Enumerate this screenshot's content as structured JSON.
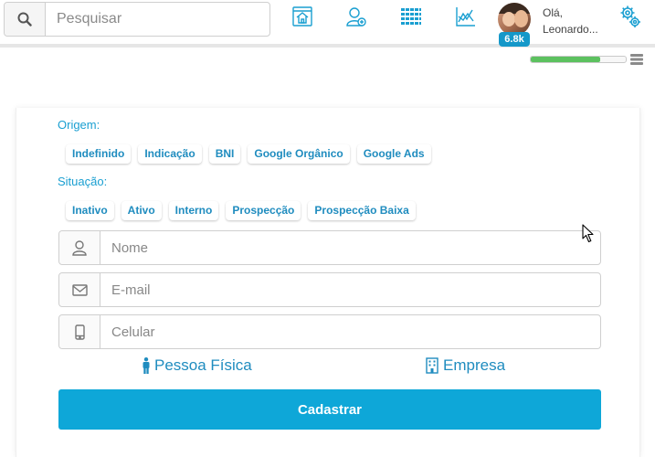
{
  "header": {
    "search_placeholder": "Pesquisar",
    "user": {
      "badge": "6.8k",
      "greeting_line1": "Olá,",
      "greeting_line2": "Leonardo..."
    },
    "nav_icons": [
      "home-icon",
      "add-user-icon",
      "calendar-grid-icon",
      "chart-icon"
    ],
    "progress_fraction": 0.73
  },
  "form": {
    "origem_label": "Origem:",
    "origem_options": [
      "Indefinido",
      "Indicação",
      "BNI",
      "Google Orgânico",
      "Google Ads"
    ],
    "situacao_label": "Situação:",
    "situacao_options": [
      "Inativo",
      "Ativo",
      "Interno",
      "Prospecção",
      "Prospecção Baixa"
    ],
    "nome_placeholder": "Nome",
    "email_placeholder": "E-mail",
    "celular_placeholder": "Celular",
    "pessoa_fisica_label": "Pessoa Física",
    "empresa_label": "Empresa",
    "submit_label": "Cadastrar"
  },
  "colors": {
    "accent": "#1a9fd1",
    "button": "#0ea7d8",
    "progress": "#5cc15f"
  }
}
